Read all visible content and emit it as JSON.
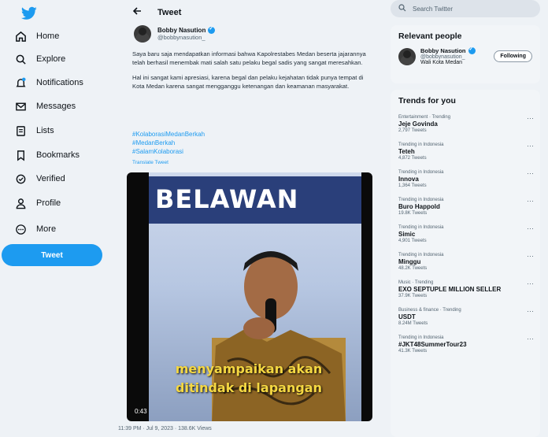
{
  "sidebar": {
    "logo": "twitter-bird-icon",
    "items": [
      {
        "label": "Home",
        "icon": "home-icon"
      },
      {
        "label": "Explore",
        "icon": "search-icon"
      },
      {
        "label": "Notifications",
        "icon": "bell-icon"
      },
      {
        "label": "Messages",
        "icon": "envelope-icon"
      },
      {
        "label": "Lists",
        "icon": "list-icon"
      },
      {
        "label": "Bookmarks",
        "icon": "bookmark-icon"
      },
      {
        "label": "Verified",
        "icon": "verified-icon"
      },
      {
        "label": "Profile",
        "icon": "user-icon"
      },
      {
        "label": "More",
        "icon": "more-icon"
      }
    ],
    "tweet_button": "Tweet"
  },
  "main": {
    "header_title": "Tweet",
    "author": {
      "name": "Bobby Nasution",
      "handle": "@bobbynasution_"
    },
    "text_p1": "Saya baru saja mendapatkan informasi bahwa Kapolrestabes Medan beserta jajarannya telah berhasil menembak mati salah satu pelaku begal sadis yang sangat meresahkan.",
    "text_p2": "Hal ini sangat kami apresiasi, karena begal dan pelaku kejahatan tidak punya tempat di Kota Medan karena sangat mengganggu ketenangan dan keamanan masyarakat.",
    "hashtags": [
      "#KolaborasiMedanBerkah",
      "#MedanBerkah",
      "#SalamKolaborasi"
    ],
    "translate": "Translate Tweet",
    "video": {
      "banner_text": "BELAWAN",
      "caption_line1": "menyampaikan akan",
      "caption_line2": "ditindak di lapangan",
      "timecode": "0:43"
    },
    "meta": "11:39 PM · Jul 9, 2023 · 138.6K Views"
  },
  "right": {
    "search_placeholder": "Search Twitter",
    "relevant_title": "Relevant people",
    "relevant": {
      "name": "Bobby Nasution",
      "handle": "@bobbynasution_",
      "bio": "Wali Kota Medan",
      "button": "Following"
    },
    "trends_title": "Trends for you",
    "trends": [
      {
        "category": "Entertainment · Trending",
        "name": "Jeje Govinda",
        "count": "2,797 Tweets"
      },
      {
        "category": "Trending in Indonesia",
        "name": "Teteh",
        "count": "4,872 Tweets"
      },
      {
        "category": "Trending in Indonesia",
        "name": "Innova",
        "count": "1,364 Tweets"
      },
      {
        "category": "Trending in Indonesia",
        "name": "Buro Happold",
        "count": "19.8K Tweets"
      },
      {
        "category": "Trending in Indonesia",
        "name": "Simic",
        "count": "4,901 Tweets"
      },
      {
        "category": "Trending in Indonesia",
        "name": "Minggu",
        "count": "48.2K Tweets"
      },
      {
        "category": "Music · Trending",
        "name": "EXO SEPTUPLE MILLION SELLER",
        "count": "37.9K Tweets"
      },
      {
        "category": "Business & finance · Trending",
        "name": "USDT",
        "count": "8.24M Tweets"
      },
      {
        "category": "Trending in Indonesia",
        "name": "#JKT48SummerTour23",
        "count": "41.3K Tweets"
      }
    ]
  },
  "colors": {
    "accent": "#1d9bf0",
    "background": "#eef2f6",
    "caption": "#f5d842"
  }
}
